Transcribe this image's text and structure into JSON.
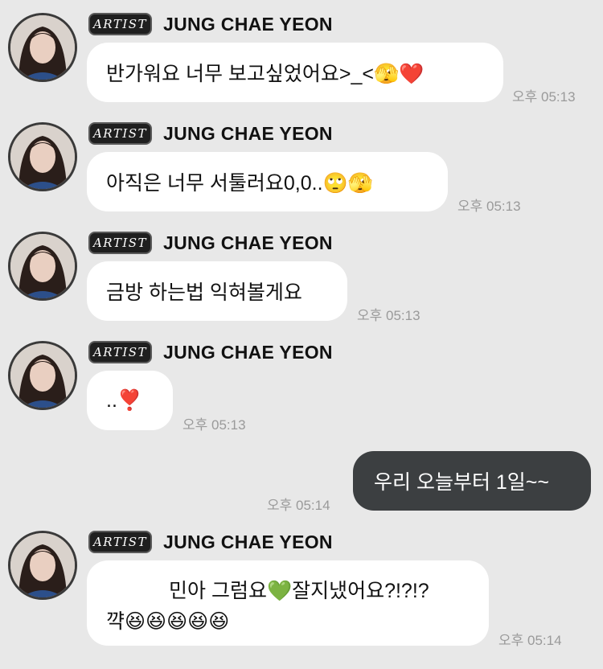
{
  "sender": {
    "badge": "ARTIST",
    "name": "JUNG CHAE YEON"
  },
  "messages": [
    {
      "text": "반가워요 너무 보고싶었어요>_<🫣❤️",
      "time": "오후 05:13"
    },
    {
      "text": "아직은 너무 서툴러요0,0..🙄🫣",
      "time": "오후 05:13"
    },
    {
      "text": "금방 하는법 익혀볼게요",
      "time": "오후 05:13"
    },
    {
      "text": "..❣️",
      "time": "오후 05:13"
    },
    {
      "line1": "민아 그럼요💚잘지냈어요?!?!?",
      "line2": "꺅😆😆😆😆😆",
      "time": "오후 05:14"
    }
  ],
  "my_message": {
    "text": "우리 오늘부터 1일~~",
    "time": "오후 05:14"
  }
}
